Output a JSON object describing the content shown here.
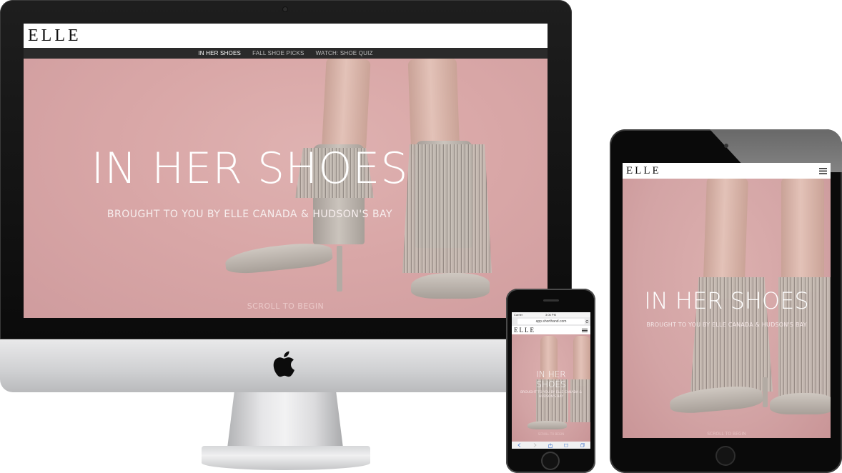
{
  "desktop": {
    "logo": "ELLE",
    "nav_items": [
      "IN HER SHOES",
      "FALL SHOE PICKS",
      "WATCH: SHOE QUIZ"
    ],
    "hero_title": "IN HER SHOES",
    "hero_subtitle": "BROUGHT TO YOU BY ELLE CANADA & HUDSON'S BAY",
    "scroll_prompt": "SCROLL TO BEGIN"
  },
  "tablet": {
    "logo": "ELLE",
    "hero_title": "IN HER SHOES",
    "hero_subtitle": "BROUGHT TO YOU BY ELLE CANADA & HUDSON'S BAY",
    "scroll_prompt": "SCROLL TO BEGIN"
  },
  "phone": {
    "status_carrier": "Carrier",
    "status_time": "3:06 PM",
    "address_bar": "app.shorthand.com",
    "logo": "ELLE",
    "hero_title_line1": "IN HER",
    "hero_title_line2": "SHOES",
    "hero_subtitle": "BROUGHT TO YOU BY ELLE CANADA & HUDSON'S BAY",
    "scroll_prompt": "SCROLL TO BEGIN"
  },
  "colors": {
    "hero_pink": "#d9a7a7",
    "nav_bg": "#2a2a2a",
    "device_black": "#0a0a0a",
    "aluminum": "#d0d1d3"
  },
  "icons": [
    "apple-logo-icon",
    "hamburger-menu-icon",
    "reload-icon",
    "back-arrow-icon",
    "forward-arrow-icon",
    "share-icon",
    "bookmarks-icon",
    "tabs-icon"
  ]
}
